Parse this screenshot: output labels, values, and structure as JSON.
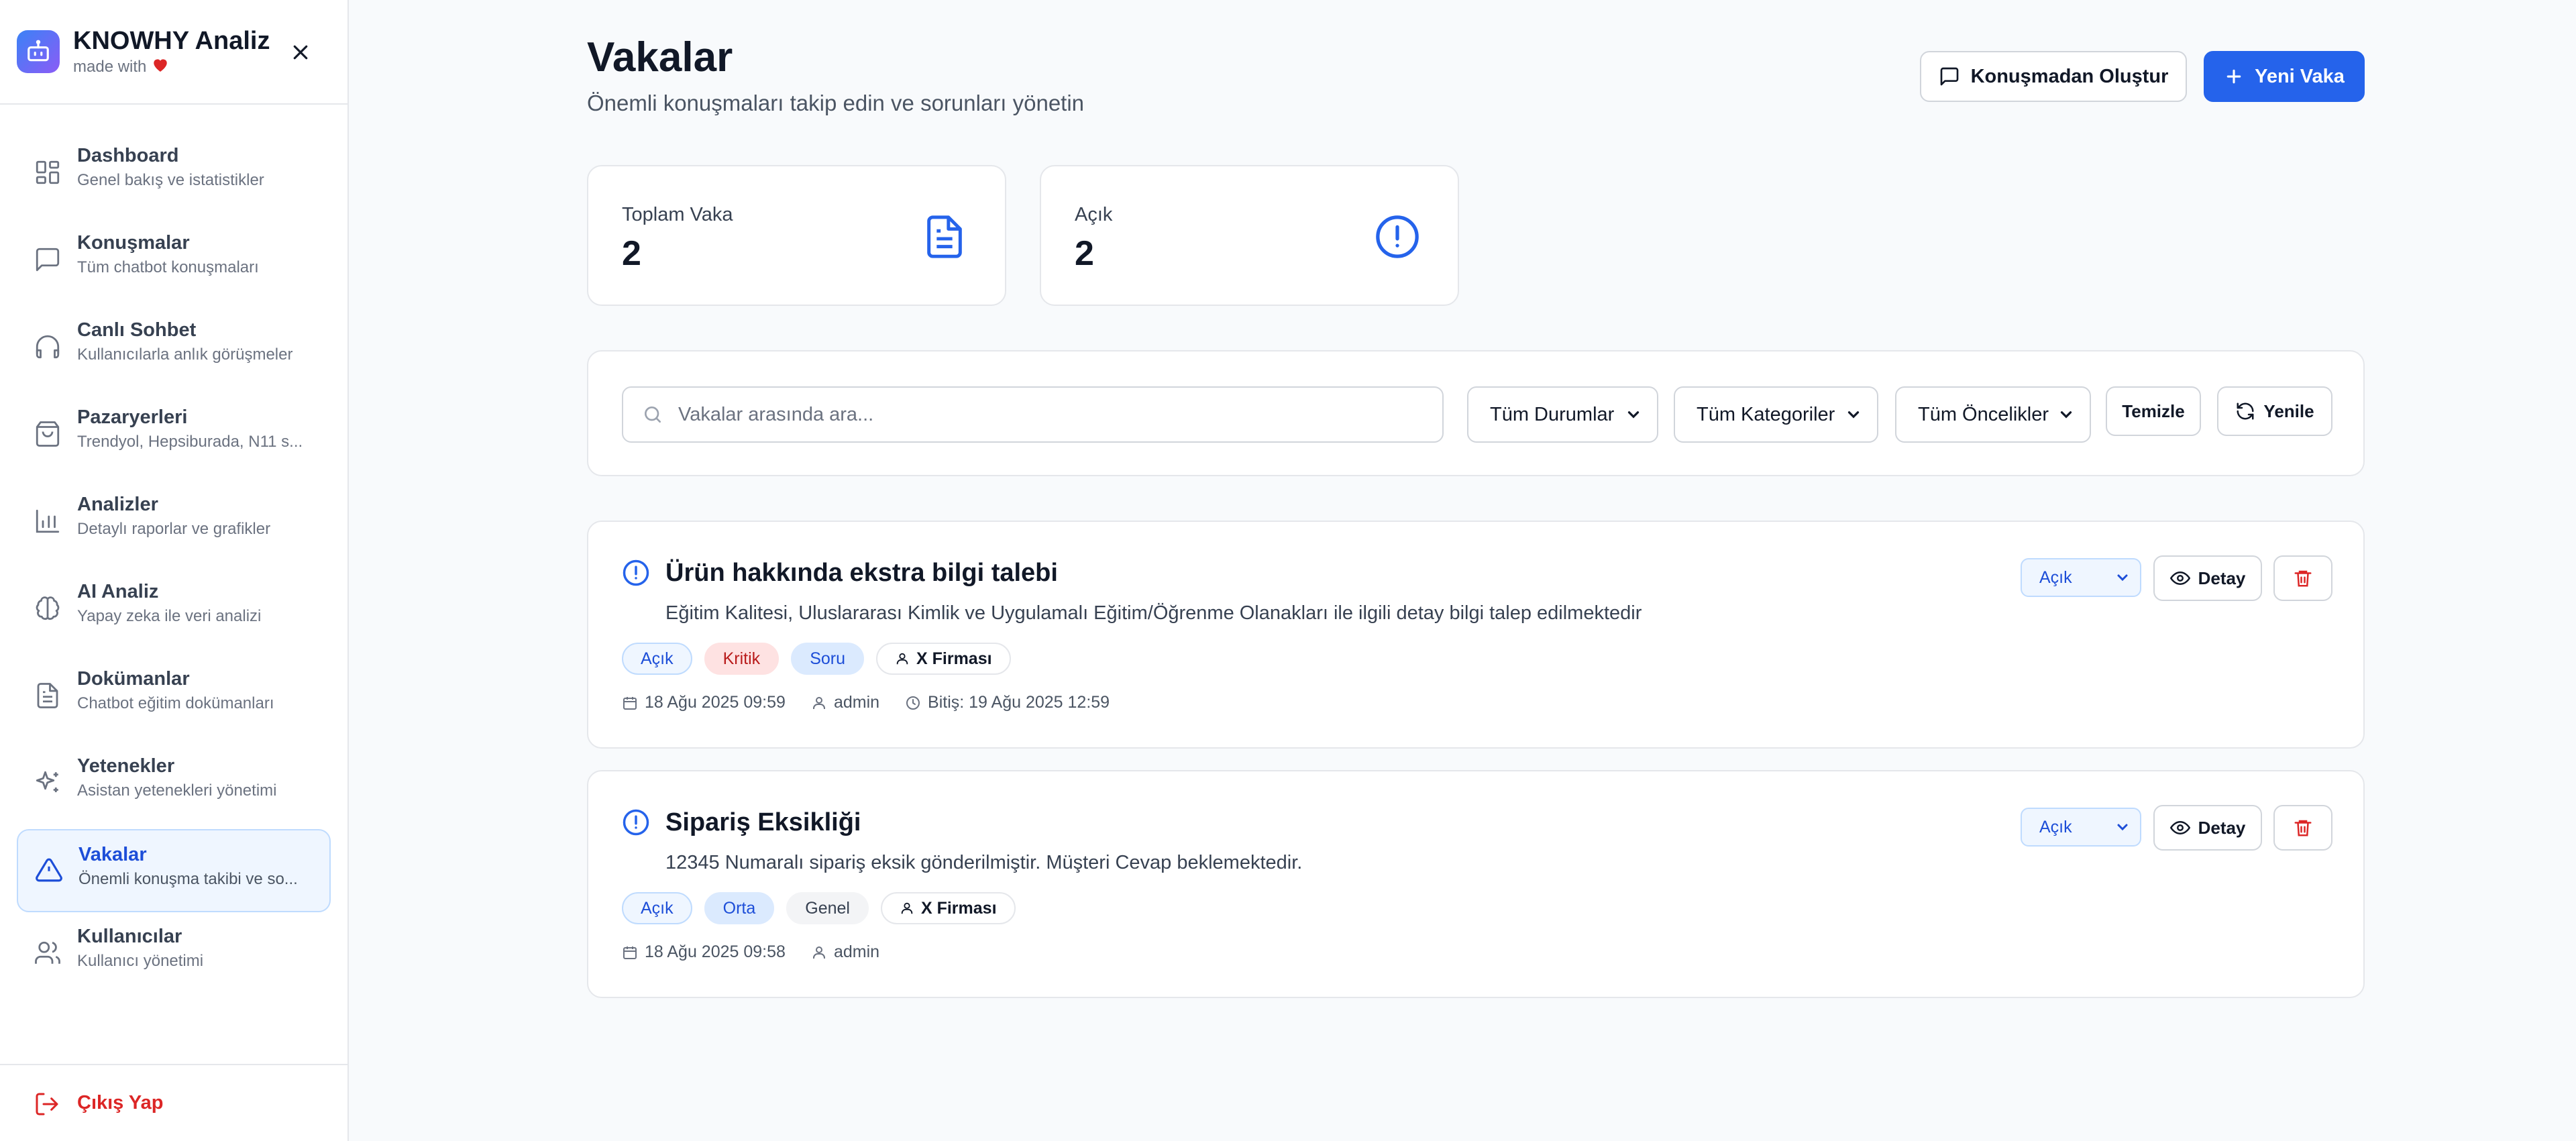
{
  "app": {
    "title": "KNOWHY Analiz",
    "subtitle": "made with"
  },
  "sidebar": {
    "items": [
      {
        "title": "Dashboard",
        "desc": "Genel bakış ve istatistikler",
        "icon": "dashboard-grid-icon"
      },
      {
        "title": "Konuşmalar",
        "desc": "Tüm chatbot konuşmaları",
        "icon": "message-square-icon"
      },
      {
        "title": "Canlı Sohbet",
        "desc": "Kullanıcılarla anlık görüşmeler",
        "icon": "headphones-icon"
      },
      {
        "title": "Pazaryerleri",
        "desc": "Trendyol, Hepsiburada, N11 s...",
        "icon": "shopping-bag-icon"
      },
      {
        "title": "Analizler",
        "desc": "Detaylı raporlar ve grafikler",
        "icon": "bar-chart-icon"
      },
      {
        "title": "AI Analiz",
        "desc": "Yapay zeka ile veri analizi",
        "icon": "brain-icon"
      },
      {
        "title": "Dokümanlar",
        "desc": "Chatbot eğitim dokümanları",
        "icon": "file-text-icon"
      },
      {
        "title": "Yetenekler",
        "desc": "Asistan yetenekleri yönetimi",
        "icon": "sparkles-icon"
      },
      {
        "title": "Vakalar",
        "desc": "Önemli konuşma takibi ve so...",
        "icon": "alert-triangle-icon",
        "active": true
      },
      {
        "title": "Kullanıcılar",
        "desc": "Kullanıcı yönetimi",
        "icon": "users-icon"
      }
    ],
    "logout_label": "Çıkış Yap"
  },
  "page": {
    "title": "Vakalar",
    "subtitle": "Önemli konuşmaları takip edin ve sorunları yönetin",
    "create_from_chat_label": "Konuşmadan Oluştur",
    "new_case_label": "Yeni Vaka"
  },
  "stats": [
    {
      "label": "Toplam Vaka",
      "value": "2",
      "icon": "file-text-icon"
    },
    {
      "label": "Açık",
      "value": "2",
      "icon": "alert-circle-icon"
    }
  ],
  "filters": {
    "search_placeholder": "Vakalar arasında ara...",
    "status": "Tüm Durumlar",
    "category": "Tüm Kategoriler",
    "priority": "Tüm Öncelikler",
    "clear_label": "Temizle",
    "refresh_label": "Yenile"
  },
  "cases": [
    {
      "title": "Ürün hakkında ekstra bilgi talebi",
      "description": "Eğitim Kalitesi, Uluslararası Kimlik ve Uygulamalı Eğitim/Öğrenme Olanakları ile ilgili detay bilgi talep edilmektedir",
      "status": "Açık",
      "priority": "Kritik",
      "category": "Soru",
      "company": "X Firması",
      "date": "18 Ağu 2025 09:59",
      "user": "admin",
      "due": "Bitiş: 19 Ağu 2025 12:59",
      "status_select": "Açık",
      "detail_label": "Detay"
    },
    {
      "title": "Sipariş Eksikliği",
      "description": "12345 Numaralı sipariş eksik gönderilmiştir. Müşteri Cevap beklemektedir.",
      "status": "Açık",
      "priority": "Orta",
      "category": "Genel",
      "company": "X Firması",
      "date": "18 Ağu 2025 09:58",
      "user": "admin",
      "status_select": "Açık",
      "detail_label": "Detay"
    }
  ],
  "colors": {
    "primary": "#2563eb",
    "danger": "#dc2626",
    "sidebar_active_bg": "#eff6ff",
    "page_bg": "#f8fafc"
  }
}
